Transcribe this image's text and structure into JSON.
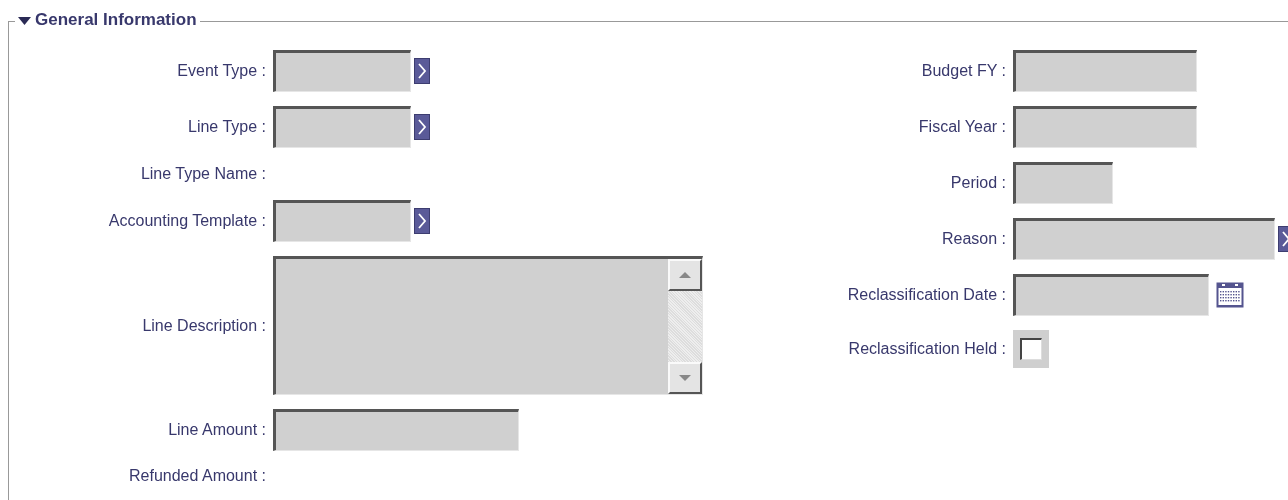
{
  "section": {
    "title": "General Information",
    "expanded": true
  },
  "left_fields": [
    {
      "label": "Event Type :",
      "kind": "lookup"
    },
    {
      "label": "Line Type :",
      "kind": "lookup"
    },
    {
      "label": "Line Type Name :",
      "kind": "display"
    },
    {
      "label": "Accounting Template :",
      "kind": "lookup"
    },
    {
      "label": "Line Description :",
      "kind": "textarea"
    },
    {
      "label": "Line Amount :",
      "kind": "text"
    },
    {
      "label": "Refunded Amount :",
      "kind": "display"
    }
  ],
  "right_fields": [
    {
      "label": "Budget FY :",
      "kind": "text"
    },
    {
      "label": "Fiscal Year :",
      "kind": "text"
    },
    {
      "label": "Period :",
      "kind": "text"
    },
    {
      "label": "Reason :",
      "kind": "lookup"
    },
    {
      "label": "Reclassification Date :",
      "kind": "date"
    },
    {
      "label": "Reclassification Held :",
      "kind": "checkbox",
      "checked": false
    }
  ]
}
